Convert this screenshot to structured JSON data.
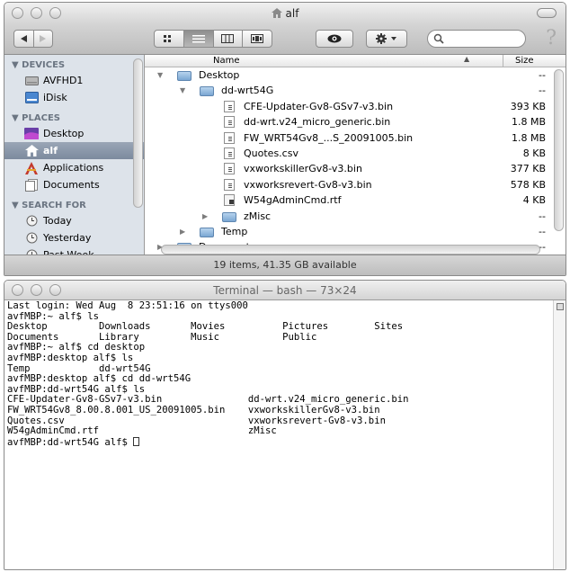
{
  "finder": {
    "title": "alf",
    "sidebar": {
      "devices_header": "DEVICES",
      "devices": [
        {
          "label": "AVFHD1",
          "icon": "hard-drive-icon"
        },
        {
          "label": "iDisk",
          "icon": "idisk-icon"
        }
      ],
      "places_header": "PLACES",
      "places": [
        {
          "label": "Desktop",
          "icon": "desktop-icon"
        },
        {
          "label": "alf",
          "icon": "home-icon",
          "selected": true
        },
        {
          "label": "Applications",
          "icon": "applications-icon"
        },
        {
          "label": "Documents",
          "icon": "documents-icon"
        }
      ],
      "search_header": "SEARCH FOR",
      "searches": [
        {
          "label": "Today",
          "icon": "clock-icon"
        },
        {
          "label": "Yesterday",
          "icon": "clock-icon"
        },
        {
          "label": "Past Week",
          "icon": "clock-icon"
        }
      ]
    },
    "columns": {
      "name": "Name",
      "size": "Size"
    },
    "rows": [
      {
        "name": "Desktop",
        "size": "--",
        "kind": "folder",
        "level": 0,
        "expanded": true
      },
      {
        "name": "dd-wrt54G",
        "size": "--",
        "kind": "folder",
        "level": 1,
        "expanded": true
      },
      {
        "name": "CFE-Updater-Gv8-GSv7-v3.bin",
        "size": "393 KB",
        "kind": "doc",
        "level": 2
      },
      {
        "name": "dd-wrt.v24_micro_generic.bin",
        "size": "1.8 MB",
        "kind": "doc",
        "level": 2
      },
      {
        "name": "FW_WRT54Gv8_...S_20091005.bin",
        "size": "1.8 MB",
        "kind": "doc",
        "level": 2
      },
      {
        "name": "Quotes.csv",
        "size": "8 KB",
        "kind": "doc",
        "level": 2
      },
      {
        "name": "vxworkskillerGv8-v3.bin",
        "size": "377 KB",
        "kind": "doc",
        "level": 2
      },
      {
        "name": "vxworksrevert-Gv8-v3.bin",
        "size": "578 KB",
        "kind": "doc",
        "level": 2
      },
      {
        "name": "W54gAdminCmd.rtf",
        "size": "4 KB",
        "kind": "rtf",
        "level": 2
      },
      {
        "name": "zMisc",
        "size": "--",
        "kind": "folder",
        "level": 2,
        "expanded": false
      },
      {
        "name": "Temp",
        "size": "--",
        "kind": "folder",
        "level": 1,
        "expanded": false
      },
      {
        "name": "Documents",
        "size": "--",
        "kind": "folder",
        "level": 0,
        "expanded": false
      }
    ],
    "status": "19 items, 41.35 GB available",
    "colors": {
      "folder": "#7aa6d2",
      "sidebar_bg": "#dde3ea",
      "selection": "#8593a7"
    }
  },
  "terminal": {
    "title": "Terminal — bash — 73×24",
    "lines": [
      "Last login: Wed Aug  8 23:51:16 on ttys000",
      "avfMBP:~ alf$ ls",
      "Desktop         Downloads       Movies          Pictures        Sites",
      "Documents       Library         Music           Public",
      "avfMBP:~ alf$ cd desktop",
      "avfMBP:desktop alf$ ls",
      "Temp            dd-wrt54G",
      "avfMBP:desktop alf$ cd dd-wrt54G",
      "avfMBP:dd-wrt54G alf$ ls",
      "CFE-Updater-Gv8-GSv7-v3.bin               dd-wrt.v24_micro_generic.bin",
      "FW_WRT54Gv8_8.00.8.001_US_20091005.bin    vxworkskillerGv8-v3.bin",
      "Quotes.csv                                vxworksrevert-Gv8-v3.bin",
      "W54gAdminCmd.rtf                          zMisc"
    ],
    "prompt": "avfMBP:dd-wrt54G alf$ "
  }
}
